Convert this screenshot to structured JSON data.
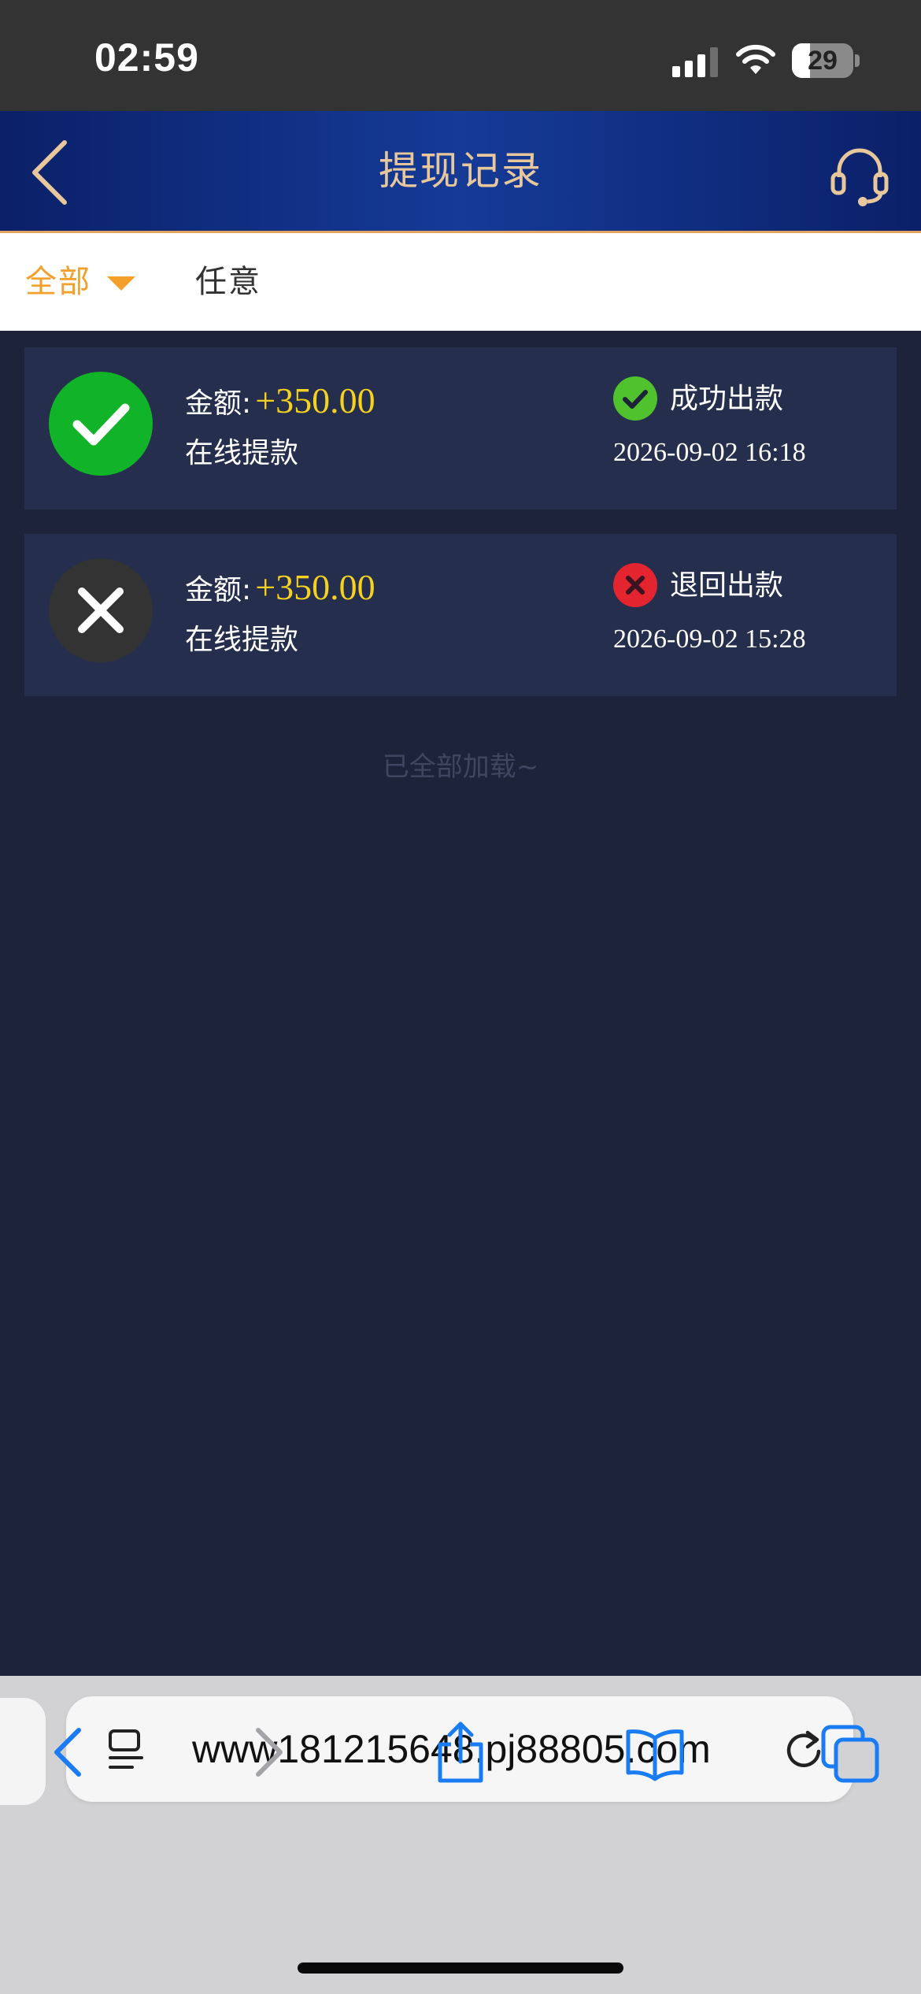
{
  "status_bar": {
    "time": "02:59",
    "battery": "29",
    "battery_level": 0.29
  },
  "header": {
    "title": "提现记录",
    "back_icon": "chevron-left-icon",
    "support_icon": "headset-icon"
  },
  "filter": {
    "all_label": "全部",
    "any_label": "任意"
  },
  "records": [
    {
      "amount_label": "金额:",
      "amount": "+350.00",
      "method": "在线提款",
      "status": "成功出款",
      "date": "2026-09-02 16:18",
      "icon": "check-circle-icon",
      "icon_color": "#11b428"
    },
    {
      "amount_label": "金额:",
      "amount": "+350.00",
      "method": "在线提款",
      "status": "退回出款",
      "date": "2026-09-02 15:28",
      "icon": "x-circle-icon",
      "icon_color": "#333333"
    }
  ],
  "footer_text": "已全部加载~",
  "browser": {
    "url": "www181215648.pj88805.com"
  },
  "colors": {
    "accent": "#f59f2b",
    "amount": "#f5d21f",
    "header_title": "#e8c79c",
    "success": "#4fc22d",
    "failure": "#e4252f",
    "ios_blue": "#1a7cf2"
  }
}
